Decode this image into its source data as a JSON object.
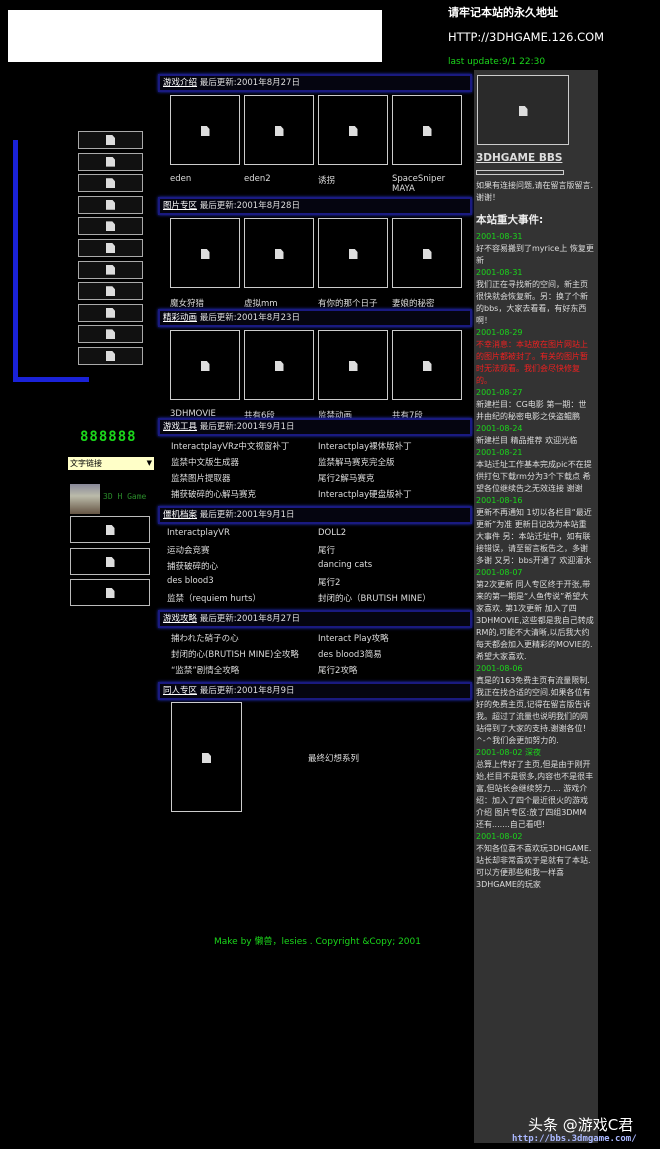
{
  "header": {
    "notice": "请牢记本站的永久地址",
    "url": "HTTP://3DHGAME.126.COM",
    "last_update": "last update:9/1 22:30"
  },
  "left": {
    "nav_button_count": 11,
    "counter": "888888",
    "select_value": "文字链接",
    "avatar_label": "3D H Game"
  },
  "sections": [
    {
      "title": "游戏介绍",
      "updated": "最后更新:2001年8月27日",
      "thumbs": [
        "eden",
        "eden2",
        "诱拐",
        "SpaceSniper MAYA"
      ]
    },
    {
      "title": "图片专区",
      "updated": "最后更新:2001年8月28日",
      "thumbs": [
        "魔女狩猎",
        "虚拟mm",
        "有你的那个日子",
        "妻娘的秘密"
      ]
    },
    {
      "title": "精彩动画",
      "updated": "最后更新:2001年8月23日",
      "thumbs": [
        "3DHMOVIE",
        "共有6段",
        "监禁动画",
        "共有7段"
      ]
    },
    {
      "title": "游戏工具",
      "updated": "最后更新:2001年9月1日",
      "links": [
        "InteractplayVRz中文视窗补丁",
        "Interactplay裸体版补丁",
        "监禁中文版生成器",
        "监禁解马赛克完全版",
        "监禁图片提取器",
        "尾行2解马赛克",
        "捕获破碎的心解马赛克",
        "Interactplay硬盘版补丁"
      ]
    },
    {
      "title": "僵机档案",
      "updated": "最后更新:2001年9月1日",
      "links": [
        "InteractplayVR",
        "DOLL2",
        "运动会竞赛",
        "尾行",
        "捕获破碎的心",
        "dancing cats",
        "des blood3",
        "尾行2",
        "监禁（requiem hurts）",
        "封闭的心（BRUTISH MINE）"
      ]
    },
    {
      "title": "游戏攻略",
      "updated": "最后更新:2001年8月27日",
      "links": [
        "捕われた硝子の心",
        "Interact Play攻略",
        "封闭的心(BRUTISH MINE)全攻略",
        "des blood3简易",
        "“监禁”剧情全攻略",
        "尾行2攻略"
      ]
    },
    {
      "title": "同人专区",
      "updated": "最后更新:2001年8月9日",
      "item": "最终幻想系列"
    }
  ],
  "right": {
    "bbs": "3DHGAME BBS",
    "bbs_note": "如果有连接问题,请在留言版留言.谢谢！",
    "events_title": "本站重大事件:",
    "events": [
      {
        "date": "2001-08-31",
        "text": "好不容易搬到了myrice上 恢复更新"
      },
      {
        "date": "2001-08-31",
        "text": "我们正在寻找新的空间，新主页很快就会恢复新。另：换了个新的bbs，大家去看看，有好东西啊！"
      },
      {
        "date": "2001-08-29",
        "text": "不幸消息：本站放在图片网站上的图片都被封了。有关的图片暂时无法观看。我们会尽快修复的。",
        "red": true
      },
      {
        "date": "2001-08-27",
        "text": "新建栏目：CG电影 第一期：世井由纪的秘密电影之侠盗鲲鹏"
      },
      {
        "date": "2001-08-24",
        "text": "新建栏目 精品推荐 欢迎光临"
      },
      {
        "date": "2001-08-21",
        "text": "本站迁址工作基本完成pic不在提供打包下载rm分为3个下载点 希望各位继续告之无效连接 谢谢"
      },
      {
        "date": "2001-08-16",
        "text": "更新不再通知 1切以各栏目“最近更新”为准 更新日记改为本站重大事件 另：本站迁址中，如有联接错误，请至留言板告之，多谢 多谢 又另：bbs开通了 欢迎灌水"
      },
      {
        "date": "2001-08-07",
        "text": "第2次更新 同人专区终于开张,带来的第一期是“人鱼传说”希望大家喜欢. 第1次更新 加入了四3DHMOVIE,这些都是我自己转成RM的,可能不大清晰,以后我大约每天都会加入更精彩的MOVIE的.希望大家喜欢."
      },
      {
        "date": "2001-08-06",
        "text": "真是的163免费主页有流量限制.我正在找合适的空间.如果各位有好的免费主页,记得在留言版告诉我。超过了流量也说明我们的网站得到了大家的支持.谢谢各位！^-^我们会更加努力的."
      },
      {
        "date": "2001-08-02 深夜",
        "text": "总算上传好了主页,但是由于刚开始,栏目不是很多,内容也不是很丰富,但站长会继续努力.... 游戏介绍：加入了四个最近很火的游戏介绍 图片专区:放了四组3DMM 还有.......自己看吧!"
      },
      {
        "date": "2001-08-02",
        "text": "不知各位喜不喜欢玩3DHGAME.站长却非常喜欢于是就有了本站.可以方便那些和我一样喜3DHGAME的玩家"
      }
    ]
  },
  "footer": "Make by 懒兽，lesies . Copyright &Copy; 2001",
  "watermark": {
    "brand": "头条 @游戏C君",
    "url": "http://bbs.3dmgame.com/"
  }
}
